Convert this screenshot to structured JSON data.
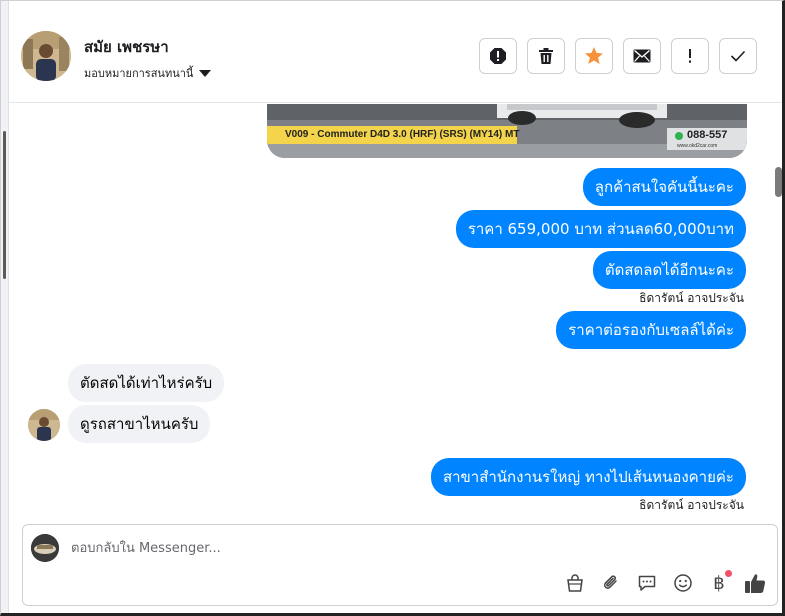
{
  "header": {
    "contact_name": "สมัย เพชรษา",
    "assign_label": "มอบหมายการสนทนานี้"
  },
  "toolbar": {
    "items": [
      {
        "name": "spam-icon"
      },
      {
        "name": "trash-icon"
      },
      {
        "name": "star-icon",
        "color": "#f7923b"
      },
      {
        "name": "envelope-icon"
      },
      {
        "name": "exclamation-icon"
      },
      {
        "name": "check-icon"
      }
    ]
  },
  "thread": {
    "car_caption": "V009 - Commuter D4D 3.0 (HRF) (SRS) (MY14) MT",
    "car_phone": "088-557",
    "car_site": "www.okd2car.com",
    "outgoing_1": "ลูกค้าสนใจคันนี้นะคะ",
    "outgoing_2": "ราคา 659,000 บาท  ส่วนลด60,000บาท",
    "outgoing_3": "ตัดสดลดได้อีกนะคะ",
    "sender_1": "ธิดารัตน์ อาจประจัน",
    "outgoing_4": "ราคาต่อรองกับเซลล์ได้ค่ะ",
    "incoming_1": "ตัดสดได้เท่าไหร่ครับ",
    "incoming_2": "ดูรถสาขาไหนครับ",
    "outgoing_5": "สาขาสำนักงานรใหญ่ ทางไปเส้นหนองคายค่ะ",
    "sender_2": "ธิดารัตน์ อาจประจัน"
  },
  "composer": {
    "placeholder": "ตอบกลับใน Messenger...",
    "value": "",
    "baht_symbol": "฿"
  },
  "colors": {
    "outgoing_bubble": "#0084ff",
    "incoming_bubble": "#f0f2f5",
    "notification_dot": "#f25268",
    "like_icon": "#444444"
  }
}
